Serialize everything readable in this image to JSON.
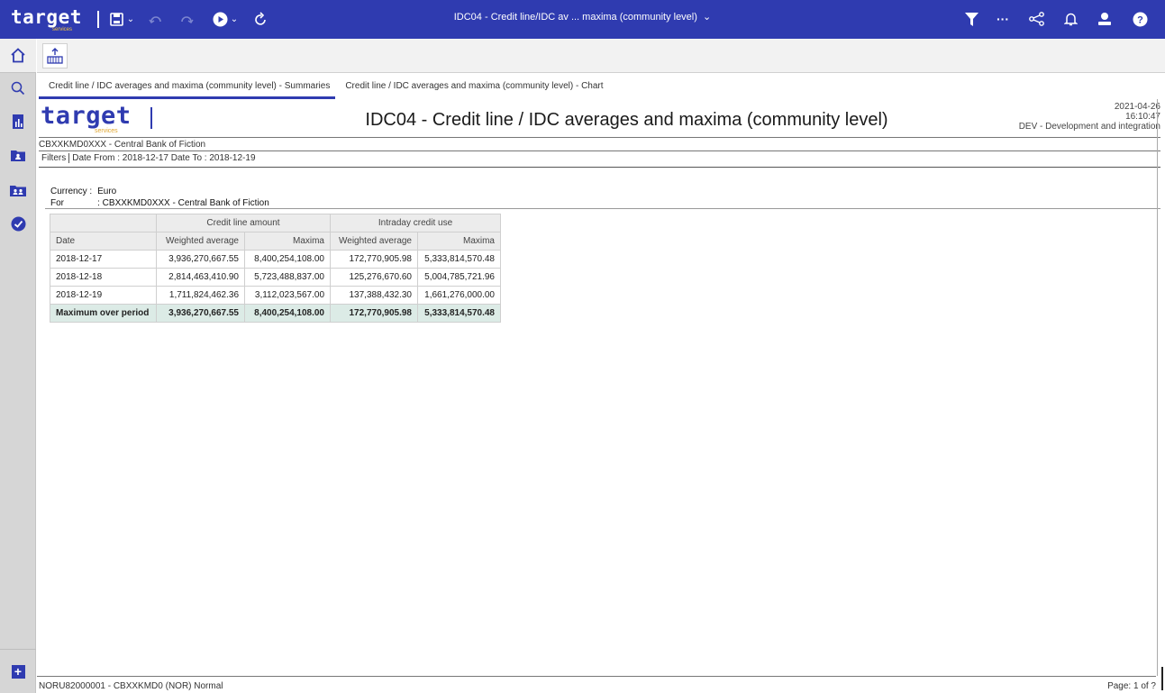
{
  "topbar": {
    "logo_word": "target",
    "logo_sub": "services",
    "title": "IDC04 - Credit line/IDC av ... maxima (community level)",
    "icons": [
      "save-icon",
      "undo-icon",
      "redo-icon",
      "run-icon",
      "refresh-icon",
      "filter-icon",
      "more-icon",
      "share-icon",
      "bell-icon",
      "user-icon",
      "help-icon"
    ]
  },
  "tabs": [
    {
      "label": "Credit line / IDC averages and maxima (community level) - Summaries",
      "active": true
    },
    {
      "label": "Credit line / IDC averages and maxima (community level) - Chart",
      "active": false
    }
  ],
  "report": {
    "logo_word": "target",
    "logo_sub": "services",
    "title": "IDC04 - Credit line / IDC averages and maxima (community level)",
    "date": "2021-04-26",
    "time": "16:10:47",
    "environment": "DEV - Development and integration",
    "participant": "CBXXKMD0XXX - Central Bank of Fiction",
    "filters_label": "Filters",
    "filters_text": "Date From : 2018-12-17   Date To : 2018-12-19",
    "currency_key": "Currency :",
    "currency_val": "Euro",
    "for_key": "For",
    "for_val": ": CBXXKMD0XXX - Central Bank of Fiction"
  },
  "table": {
    "group_headers": [
      "Credit line amount",
      "Intraday credit use"
    ],
    "columns": [
      "Date",
      "Weighted average",
      "Maxima",
      "Weighted average",
      "Maxima"
    ],
    "rows": [
      [
        "2018-12-17",
        "3,936,270,667.55",
        "8,400,254,108.00",
        "172,770,905.98",
        "5,333,814,570.48"
      ],
      [
        "2018-12-18",
        "2,814,463,410.90",
        "5,723,488,837.00",
        "125,276,670.60",
        "5,004,785,721.96"
      ],
      [
        "2018-12-19",
        "1,711,824,462.36",
        "3,112,023,567.00",
        "137,388,432.30",
        "1,661,276,000.00"
      ]
    ],
    "total": [
      "Maximum over period",
      "3,936,270,667.55",
      "8,400,254,108.00",
      "172,770,905.98",
      "5,333,814,570.48"
    ]
  },
  "footer": {
    "user": "NORU82000001 - CBXXKMD0 (NOR) Normal",
    "page": "Page:  1 of ?"
  },
  "colors": {
    "brand": "#2f3bb0",
    "accent": "#e0a52d",
    "total_row": "#dcebe6"
  }
}
